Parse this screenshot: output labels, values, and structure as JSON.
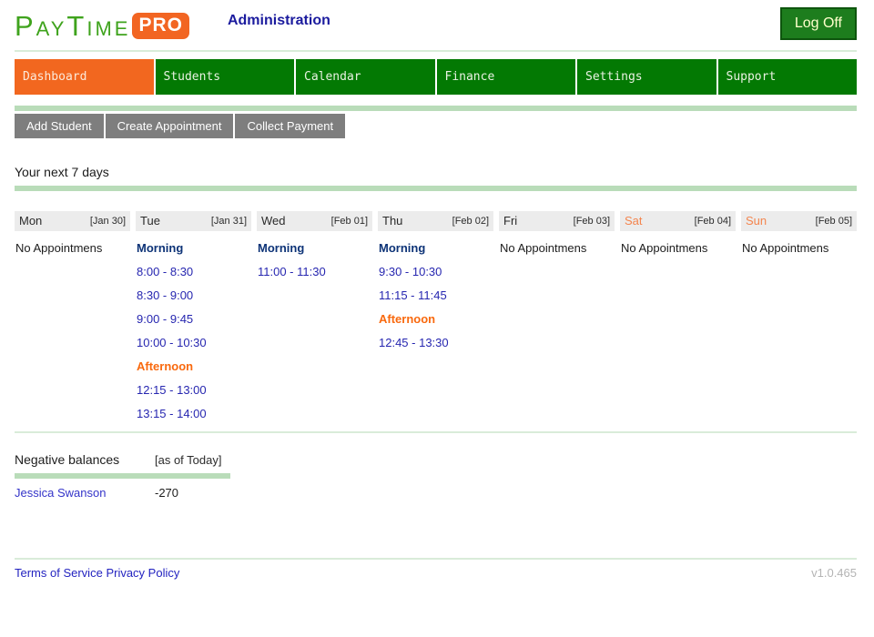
{
  "header": {
    "logo_text": "PayTime",
    "logo_badge": "PRO",
    "title": "Administration",
    "logoff_label": "Log Off"
  },
  "nav": {
    "items": [
      {
        "label": "Dashboard",
        "active": true
      },
      {
        "label": "Students",
        "active": false
      },
      {
        "label": "Calendar",
        "active": false
      },
      {
        "label": "Finance",
        "active": false
      },
      {
        "label": "Settings",
        "active": false
      },
      {
        "label": "Support",
        "active": false
      }
    ]
  },
  "quick_actions": [
    "Add Student",
    "Create Appointment",
    "Collect Payment"
  ],
  "week": {
    "heading": "Your next 7 days",
    "no_appointments_label": "No Appointmens",
    "days": [
      {
        "name": "Mon",
        "date": "[Jan 30]",
        "weekend": false,
        "slots": []
      },
      {
        "name": "Tue",
        "date": "[Jan 31]",
        "weekend": false,
        "slots": [
          {
            "kind": "period",
            "style": "morning",
            "label": "Morning"
          },
          {
            "kind": "time",
            "label": "8:00 - 8:30"
          },
          {
            "kind": "time",
            "label": "8:30 - 9:00"
          },
          {
            "kind": "time",
            "label": "9:00 - 9:45"
          },
          {
            "kind": "time",
            "label": "10:00 - 10:30"
          },
          {
            "kind": "period",
            "style": "afternoon",
            "label": "Afternoon"
          },
          {
            "kind": "time",
            "label": "12:15 - 13:00"
          },
          {
            "kind": "time",
            "label": "13:15 - 14:00"
          }
        ]
      },
      {
        "name": "Wed",
        "date": "[Feb 01]",
        "weekend": false,
        "slots": [
          {
            "kind": "period",
            "style": "morning",
            "label": "Morning"
          },
          {
            "kind": "time",
            "label": "11:00 - 11:30"
          }
        ]
      },
      {
        "name": "Thu",
        "date": "[Feb 02]",
        "weekend": false,
        "slots": [
          {
            "kind": "period",
            "style": "morning",
            "label": "Morning"
          },
          {
            "kind": "time",
            "label": "9:30 - 10:30"
          },
          {
            "kind": "time",
            "label": "11:15 - 11:45"
          },
          {
            "kind": "period",
            "style": "afternoon",
            "label": "Afternoon"
          },
          {
            "kind": "time",
            "label": "12:45 - 13:30"
          }
        ]
      },
      {
        "name": "Fri",
        "date": "[Feb 03]",
        "weekend": false,
        "slots": []
      },
      {
        "name": "Sat",
        "date": "[Feb 04]",
        "weekend": true,
        "slots": []
      },
      {
        "name": "Sun",
        "date": "[Feb 05]",
        "weekend": true,
        "slots": []
      }
    ]
  },
  "balances": {
    "heading": "Negative balances",
    "as_of": "[as of Today]",
    "rows": [
      {
        "name": "Jessica Swanson",
        "amount": "-270"
      }
    ]
  },
  "footer": {
    "links": [
      "Terms of Service",
      "Privacy Policy"
    ],
    "version": "v1.0.465"
  }
}
